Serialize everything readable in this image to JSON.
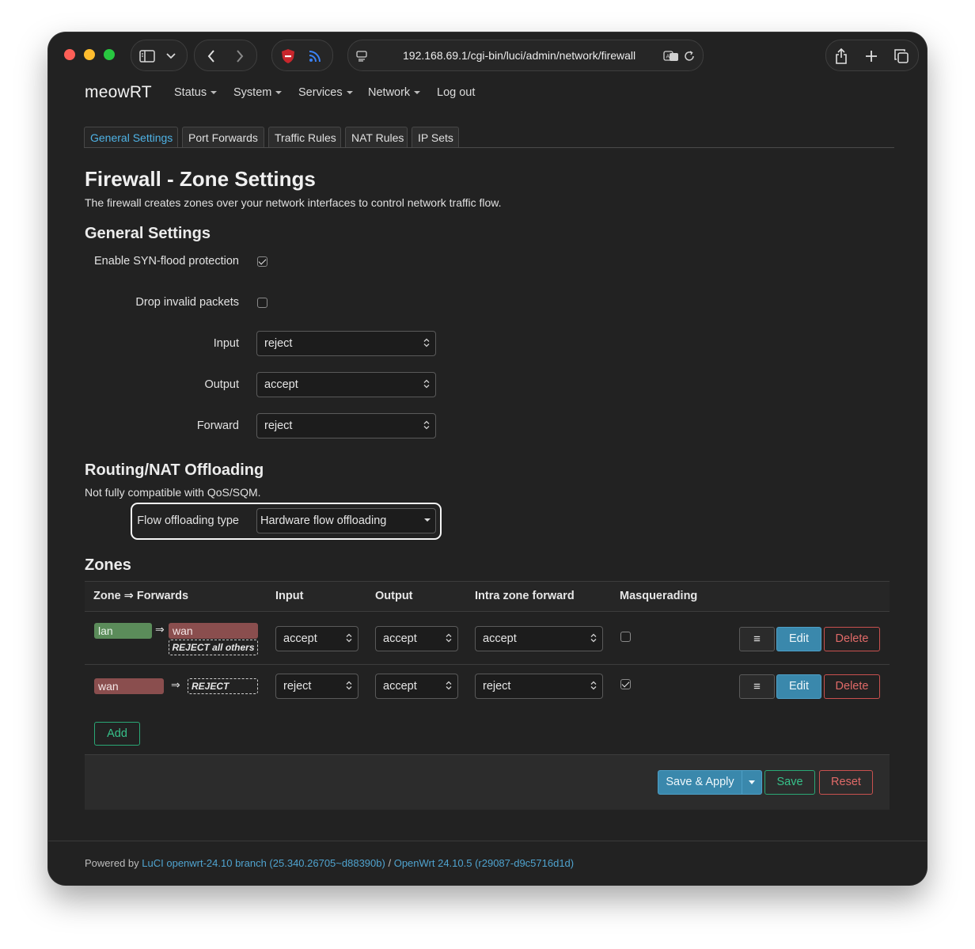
{
  "browser": {
    "url": "192.168.69.1/cgi-bin/luci/admin/network/firewall"
  },
  "nav": {
    "brand": "meowRT",
    "items": [
      "Status",
      "System",
      "Services",
      "Network"
    ],
    "logout": "Log out"
  },
  "tabs": [
    "General Settings",
    "Port Forwards",
    "Traffic Rules",
    "NAT Rules",
    "IP Sets"
  ],
  "page": {
    "title": "Firewall - Zone Settings",
    "description": "The firewall creates zones over your network interfaces to control network traffic flow."
  },
  "general": {
    "heading": "General Settings",
    "syn_flood_label": "Enable SYN-flood protection",
    "syn_flood_checked": true,
    "drop_invalid_label": "Drop invalid packets",
    "drop_invalid_checked": false,
    "input_label": "Input",
    "input_value": "reject",
    "output_label": "Output",
    "output_value": "accept",
    "forward_label": "Forward",
    "forward_value": "reject"
  },
  "offloading": {
    "heading": "Routing/NAT Offloading",
    "note": "Not fully compatible with QoS/SQM.",
    "type_label": "Flow offloading type",
    "type_value": "Hardware flow offloading"
  },
  "zones": {
    "heading": "Zones",
    "columns": [
      "Zone ⇒ Forwards",
      "Input",
      "Output",
      "Intra zone forward",
      "Masquerading"
    ],
    "rows": [
      {
        "zone": "lan",
        "arrow": "⇒",
        "forward_target": "wan",
        "forward_note": "REJECT all others",
        "input": "accept",
        "output": "accept",
        "intra": "accept",
        "masquerading": false
      },
      {
        "zone": "wan",
        "arrow": "⇒",
        "forward_note": "REJECT",
        "input": "reject",
        "output": "accept",
        "intra": "reject",
        "masquerading": true
      }
    ],
    "drag_label": "≡",
    "edit_label": "Edit",
    "delete_label": "Delete",
    "add_label": "Add"
  },
  "actions": {
    "save_apply": "Save & Apply",
    "save": "Save",
    "reset": "Reset"
  },
  "footer": {
    "prefix": "Powered by",
    "luci": "LuCI openwrt-24.10 branch (25.340.26705~d88390b)",
    "sep": "/",
    "openwrt": "OpenWrt 24.10.5 (r29087-d9c5716d1d)"
  },
  "colors": {
    "accent": "#3a88ac",
    "positive": "#2aa876",
    "negative": "#c9514f",
    "zone_lan": "#5b8c5a",
    "zone_wan": "#8a4e4e"
  }
}
